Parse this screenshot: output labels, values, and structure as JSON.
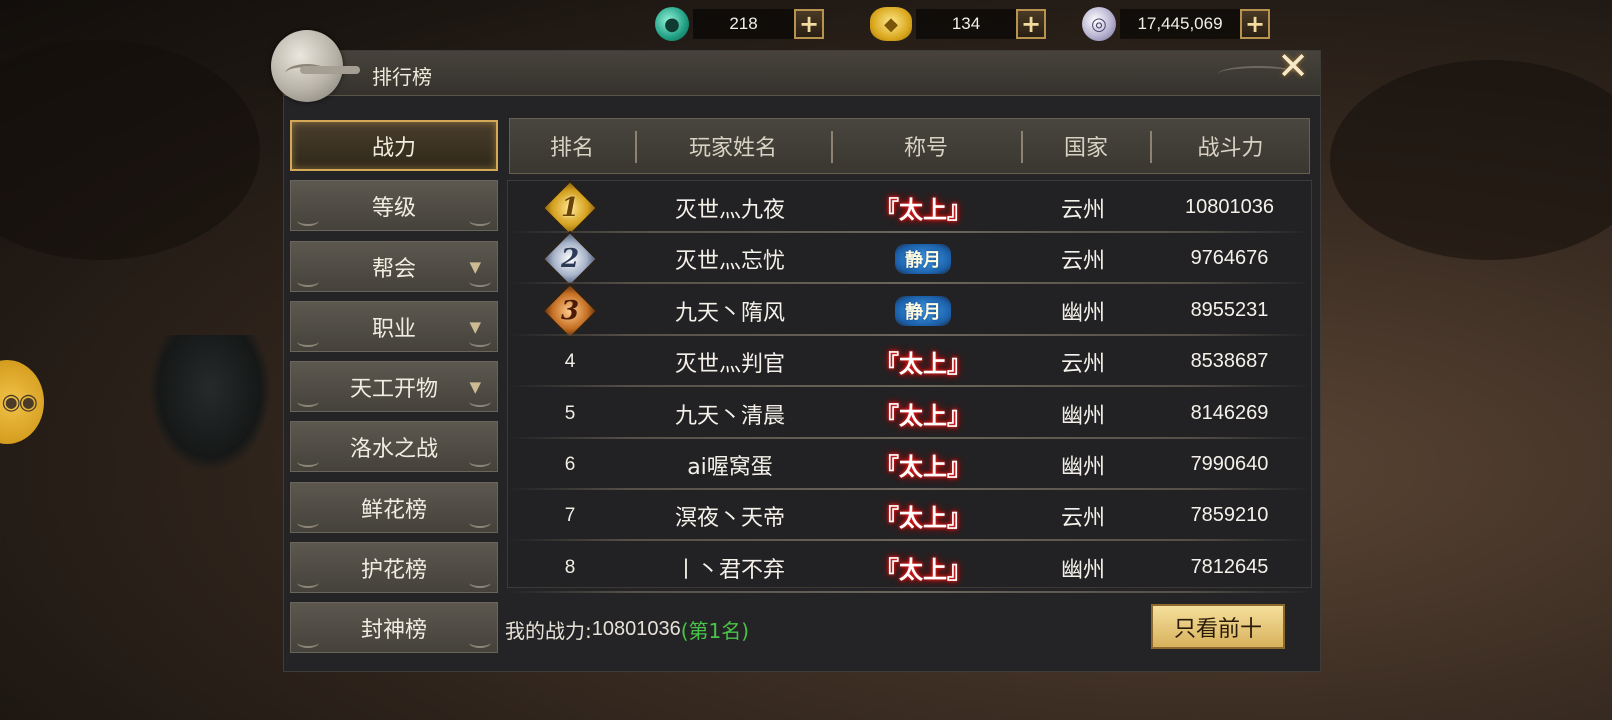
{
  "currency": {
    "jade": {
      "icon": "jade-icon",
      "value": "218"
    },
    "gold": {
      "icon": "gold-ingot-icon",
      "value": "134"
    },
    "silver": {
      "icon": "silver-coin-icon",
      "value": "17,445,069"
    },
    "plus_label": "+"
  },
  "panel": {
    "title": "排行榜",
    "close_icon": "close-icon"
  },
  "menu": [
    {
      "label": "战力",
      "active": true,
      "has_dropdown": false
    },
    {
      "label": "等级",
      "active": false,
      "has_dropdown": false
    },
    {
      "label": "帮会",
      "active": false,
      "has_dropdown": true
    },
    {
      "label": "职业",
      "active": false,
      "has_dropdown": true
    },
    {
      "label": "天工开物",
      "active": false,
      "has_dropdown": true
    },
    {
      "label": "洛水之战",
      "active": false,
      "has_dropdown": false
    },
    {
      "label": "鲜花榜",
      "active": false,
      "has_dropdown": false
    },
    {
      "label": "护花榜",
      "active": false,
      "has_dropdown": false
    },
    {
      "label": "封神榜",
      "active": false,
      "has_dropdown": false
    }
  ],
  "dropdown_glyph": "▼",
  "table": {
    "headers": [
      "排名",
      "玩家姓名",
      "称号",
      "国家",
      "战斗力"
    ],
    "rows": [
      {
        "rank": "1",
        "name": "灭世灬九夜",
        "title": "『太上』",
        "title_style": "taishang",
        "country": "云州",
        "power": "10801036"
      },
      {
        "rank": "2",
        "name": "灭世灬忘忧",
        "title": "静月",
        "title_style": "jingyue",
        "country": "云州",
        "power": "9764676"
      },
      {
        "rank": "3",
        "name": "九天丶隋风",
        "title": "静月",
        "title_style": "jingyue",
        "country": "幽州",
        "power": "8955231"
      },
      {
        "rank": "4",
        "name": "灭世灬判官",
        "title": "『太上』",
        "title_style": "taishang",
        "country": "云州",
        "power": "8538687"
      },
      {
        "rank": "5",
        "name": "九天丶清晨",
        "title": "『太上』",
        "title_style": "taishang",
        "country": "幽州",
        "power": "8146269"
      },
      {
        "rank": "6",
        "name": "ai喔窝蛋",
        "title": "『太上』",
        "title_style": "taishang",
        "country": "幽州",
        "power": "7990640"
      },
      {
        "rank": "7",
        "name": "溟夜丶天帝",
        "title": "『太上』",
        "title_style": "taishang",
        "country": "云州",
        "power": "7859210"
      },
      {
        "rank": "8",
        "name": "丨丶君不弃",
        "title": "『太上』",
        "title_style": "taishang",
        "country": "幽州",
        "power": "7812645"
      }
    ]
  },
  "footer": {
    "my_power_label": "我的战力:",
    "my_power_value": "10801036",
    "my_rank": "(第1名)",
    "top10_button": "只看前十"
  },
  "colors": {
    "accent_gold": "#d3a958",
    "rank_green": "#48c548",
    "title_red": "#d40000"
  }
}
